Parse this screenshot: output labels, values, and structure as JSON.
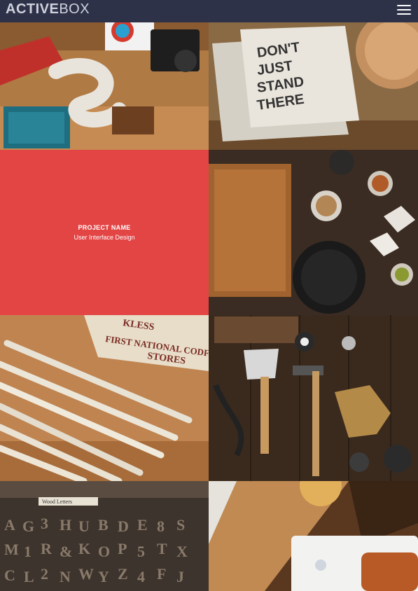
{
  "header": {
    "logo_bold": "ACTIVE",
    "logo_light": "BOX",
    "menu_icon": "hamburger-menu-icon",
    "bg_color": "#2e3249"
  },
  "portfolio": {
    "tiles": [
      {
        "subject": "desk-with-camera-and-ampersand"
      },
      {
        "subject": "notebook-dont-just-stand-there",
        "text": "DON'T JUST STAND THERE"
      },
      {
        "subject": "project-overlay"
      },
      {
        "subject": "cutting-board-spices-pan"
      },
      {
        "subject": "rulers-and-codfish-crate",
        "text": "KLESS FIRST NATIONAL CODFISH STORES"
      },
      {
        "subject": "axe-hammer-gloves-tools"
      },
      {
        "subject": "wooden-type-letters",
        "text": "Wood Letters"
      },
      {
        "subject": "food-plate-on-table"
      }
    ],
    "overlay": {
      "title": "PROJECT NAME",
      "subtitle": "User Interface Design",
      "color": "#e34545"
    }
  }
}
